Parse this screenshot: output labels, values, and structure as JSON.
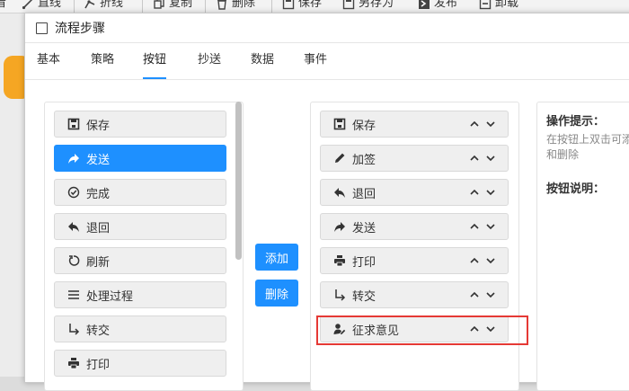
{
  "toolbar": {
    "items": [
      {
        "label": "直线",
        "icon": "line-icon"
      },
      {
        "label": "折线",
        "icon": "polyline-icon"
      },
      {
        "label": "复制",
        "icon": "copy-icon"
      },
      {
        "label": "删除",
        "icon": "trash-icon"
      },
      {
        "label": "保存",
        "icon": "save-icon"
      },
      {
        "label": "另存为",
        "icon": "save-as-icon"
      },
      {
        "label": "发布",
        "icon": "publish-icon"
      },
      {
        "label": "卸载",
        "icon": "uninstall-icon"
      }
    ],
    "edge_glyph": "看"
  },
  "dialog": {
    "title": "流程步骤",
    "tabs": [
      "基本",
      "策略",
      "按钮",
      "抄送",
      "数据",
      "事件"
    ],
    "active_tab": "按钮"
  },
  "available_buttons": [
    {
      "label": "保存",
      "icon": "save-icon"
    },
    {
      "label": "发送",
      "icon": "send-icon",
      "selected": true
    },
    {
      "label": "完成",
      "icon": "check-circle-icon"
    },
    {
      "label": "退回",
      "icon": "reply-icon"
    },
    {
      "label": "刷新",
      "icon": "refresh-icon"
    },
    {
      "label": "处理过程",
      "icon": "list-icon"
    },
    {
      "label": "转交",
      "icon": "turn-arrow-icon"
    },
    {
      "label": "打印",
      "icon": "print-icon"
    }
  ],
  "actions": {
    "add": "添加",
    "delete": "删除"
  },
  "selected_buttons": [
    {
      "label": "保存",
      "icon": "save-icon"
    },
    {
      "label": "加签",
      "icon": "pencil-icon"
    },
    {
      "label": "退回",
      "icon": "reply-icon"
    },
    {
      "label": "发送",
      "icon": "send-icon"
    },
    {
      "label": "打印",
      "icon": "print-icon"
    },
    {
      "label": "转交",
      "icon": "turn-arrow-icon"
    },
    {
      "label": "征求意见",
      "icon": "user-edit-icon",
      "highlighted": true
    }
  ],
  "hint": {
    "title": "操作提示：",
    "text": "在按钮上双击可添加和删除",
    "title2": "按钮说明："
  },
  "colors": {
    "accent": "#1e90ff",
    "highlight": "#e53935",
    "orange": "#f5a623"
  }
}
